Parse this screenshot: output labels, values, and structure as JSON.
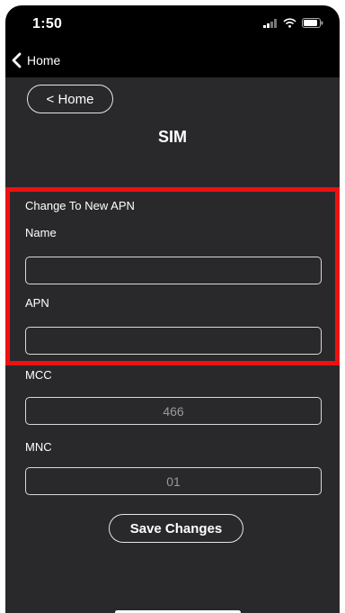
{
  "status": {
    "time": "1:50",
    "icons": [
      "signal-icon",
      "wifi-icon",
      "battery-icon"
    ]
  },
  "nav": {
    "back_label": "Home"
  },
  "header": {
    "home_button_label": "< Home",
    "title": "SIM"
  },
  "form": {
    "section_title": "Change To New APN",
    "name_label": "Name",
    "name_value": "",
    "apn_label": "APN",
    "apn_value": "",
    "mcc_label": "MCC",
    "mcc_value": "466",
    "mnc_label": "MNC",
    "mnc_value": "01"
  },
  "actions": {
    "save_label": "Save Changes"
  },
  "colors": {
    "background": "#29292c",
    "highlight": "#ee1111",
    "text": "#ffffff",
    "field_value": "#9a9a9a"
  }
}
